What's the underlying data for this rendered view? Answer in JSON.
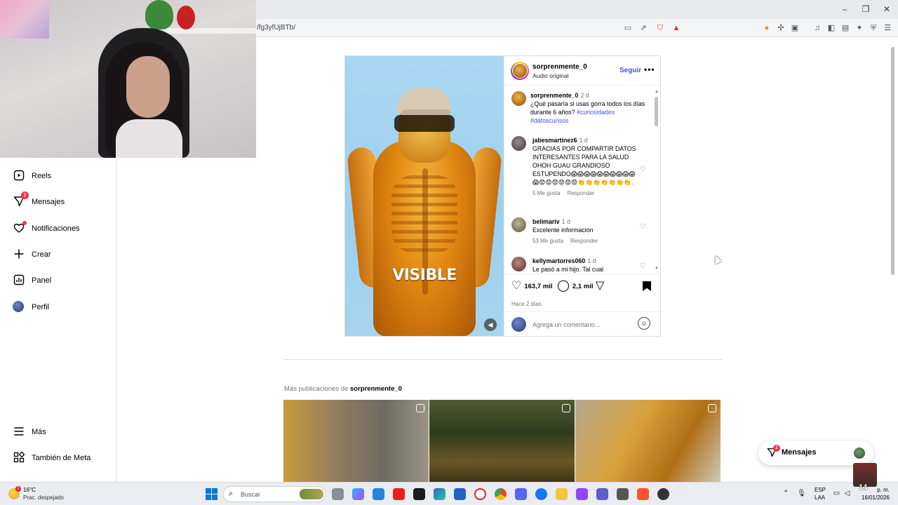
{
  "browser": {
    "url": "/fg3yfUjBTb/",
    "window_controls": [
      "–",
      "❐",
      "✕"
    ]
  },
  "sidebar": {
    "items": [
      {
        "label": "Reels",
        "icon": "reels-icon"
      },
      {
        "label": "Mensajes",
        "icon": "messages-icon",
        "badge": "1"
      },
      {
        "label": "Notificaciones",
        "icon": "heart-icon"
      },
      {
        "label": "Crear",
        "icon": "plus-icon"
      },
      {
        "label": "Panel",
        "icon": "dashboard-icon"
      },
      {
        "label": "Perfil",
        "icon": "avatar"
      }
    ],
    "bottom": [
      {
        "label": "Más",
        "icon": "menu-icon"
      },
      {
        "label": "También de Meta",
        "icon": "meta-grid-icon"
      }
    ]
  },
  "post": {
    "media_caption": "VISIBLE",
    "username": "sorprenmente_0",
    "audio": "Audio original",
    "follow_label": "Seguir",
    "more_label": "•••",
    "caption": {
      "user": "sorprenmente_0",
      "time": "2 d",
      "text": "¿Qué pasaría si usas gorra todos los días durante 6 años?",
      "hashtags": "#curiosidades #datoscurisos"
    },
    "comments": [
      {
        "user": "jabesmartinez6",
        "time": "1 d",
        "text": "GRACIAS POR COMPARTIR DATOS INTERESANTES PARA LA SALUD OHOH GUAU GRANDIOSO ESTUPENDO😱😱😱😱😱😱😱😱😱😱😱😟😟😟😟😟😟👏👏👏👏👏👏👏.",
        "likes": "5 Me gusta",
        "reply": "Responder"
      },
      {
        "user": "belimariv",
        "time": "1 d",
        "text": "Excelente información",
        "likes": "53 Me gusta",
        "reply": "Responder"
      },
      {
        "user": "kellymartorres060",
        "time": "1 d",
        "text": "Le pasó a mi hijo. Tal cual",
        "likes": "",
        "reply": ""
      }
    ],
    "likes": "163,7 mil",
    "comment_count": "2,1 mil",
    "time_ago": "Hace 2 días",
    "comment_placeholder": "Agrega un comentario..."
  },
  "more_posts": {
    "prefix": "Más publicaciones de",
    "user": "sorprenmente_0"
  },
  "messages_pill": {
    "label": "Mensajes",
    "badge": "1"
  },
  "taskbar": {
    "weather_badge": "2",
    "temperature": "16°C",
    "condition": "Prac. despejado",
    "search_label": "Buscar",
    "lang_line1": "ESP",
    "lang_line2": "LAA",
    "time": "p. m.",
    "date": "16/01/2026",
    "cam_number": "14"
  },
  "colors": {
    "accent_blue": "#4150f7",
    "notification_red": "#ff3040",
    "border": "#dbdbdb"
  }
}
